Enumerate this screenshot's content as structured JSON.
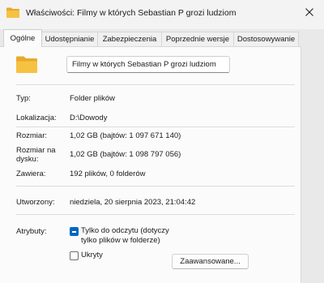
{
  "window": {
    "title": "Właściwości: Filmy w których Sebastian P grozi ludziom",
    "close_icon": "close-icon"
  },
  "tabs": [
    {
      "label": "Ogólne",
      "active": true
    },
    {
      "label": "Udostępnianie",
      "active": false
    },
    {
      "label": "Zabezpieczenia",
      "active": false
    },
    {
      "label": "Poprzednie wersje",
      "active": false
    },
    {
      "label": "Dostosowywanie",
      "active": false
    }
  ],
  "general": {
    "folder_name": "Filmy w których Sebastian P grozi ludziom",
    "rows": [
      {
        "label": "Typ:",
        "value": "Folder plików"
      },
      {
        "label": "Lokalizacja:",
        "value": "D:\\Dowody"
      },
      {
        "label": "Rozmiar:",
        "value": "1,02 GB (bajtów: 1 097 671 140)"
      },
      {
        "label": "Rozmiar na dysku:",
        "value": "1,02 GB (bajtów: 1 098 797 056)"
      },
      {
        "label": "Zawiera:",
        "value": "192 plików, 0 folderów"
      },
      {
        "label": "Utworzony:",
        "value": "niedziela, 20 sierpnia 2023, 21:04:42"
      }
    ],
    "attributes": {
      "label": "Atrybuty:",
      "readonly_label": "Tylko do odczytu (dotyczy tylko plików w folderze)",
      "readonly_state": "mixed",
      "hidden_label": "Ukryty",
      "hidden_state": "unchecked",
      "advanced_button": "Zaawansowane..."
    }
  },
  "colors": {
    "accent": "#0067c0",
    "folder_yellow": "#f5c242",
    "folder_tab": "#e8a92a"
  }
}
